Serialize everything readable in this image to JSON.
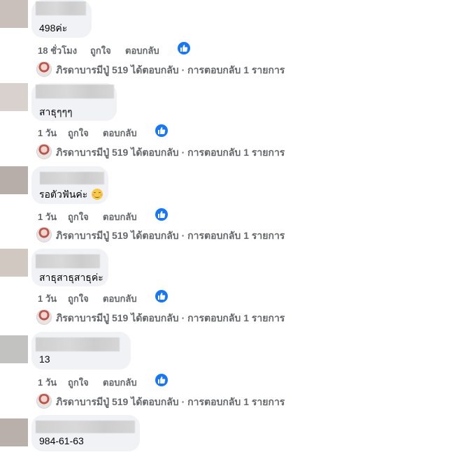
{
  "comments": [
    {
      "text": "498ค่ะ",
      "time": "18 ชั่วโมง",
      "like_label": "ถูกใจ",
      "reply_label": "ตอบกลับ",
      "reply_summary": "ภิรดาบารมีปู่ 519 ได้ตอบกลับ · การตอบกลับ 1 รายการ"
    },
    {
      "text": "สาธุๆๆๆ",
      "time": "1 วัน",
      "like_label": "ถูกใจ",
      "reply_label": "ตอบกลับ",
      "reply_summary": "ภิรดาบารมีปู่ 519 ได้ตอบกลับ · การตอบกลับ 1 รายการ"
    },
    {
      "text": "รอตัวฟันค่ะ",
      "emoji": "smiling-face-emoji",
      "time": "1 วัน",
      "like_label": "ถูกใจ",
      "reply_label": "ตอบกลับ",
      "reply_summary": "ภิรดาบารมีปู่ 519 ได้ตอบกลับ · การตอบกลับ 1 รายการ"
    },
    {
      "text": "สาธุสาธุสาธุค่ะ",
      "time": "1 วัน",
      "like_label": "ถูกใจ",
      "reply_label": "ตอบกลับ",
      "reply_summary": "ภิรดาบารมีปู่ 519 ได้ตอบกลับ · การตอบกลับ 1 รายการ"
    },
    {
      "text": "13",
      "time": "1 วัน",
      "like_label": "ถูกใจ",
      "reply_label": "ตอบกลับ",
      "reply_summary": "ภิรดาบารมีปู่ 519 ได้ตอบกลับ · การตอบกลับ 1 รายการ"
    },
    {
      "text": "984-61-63"
    }
  ],
  "icons": {
    "reaction": "like-thumbs-up-icon"
  },
  "colors": {
    "like_blue": "#1877f2",
    "bubble_bg": "#f0f2f5",
    "meta_gray": "#65676b"
  }
}
